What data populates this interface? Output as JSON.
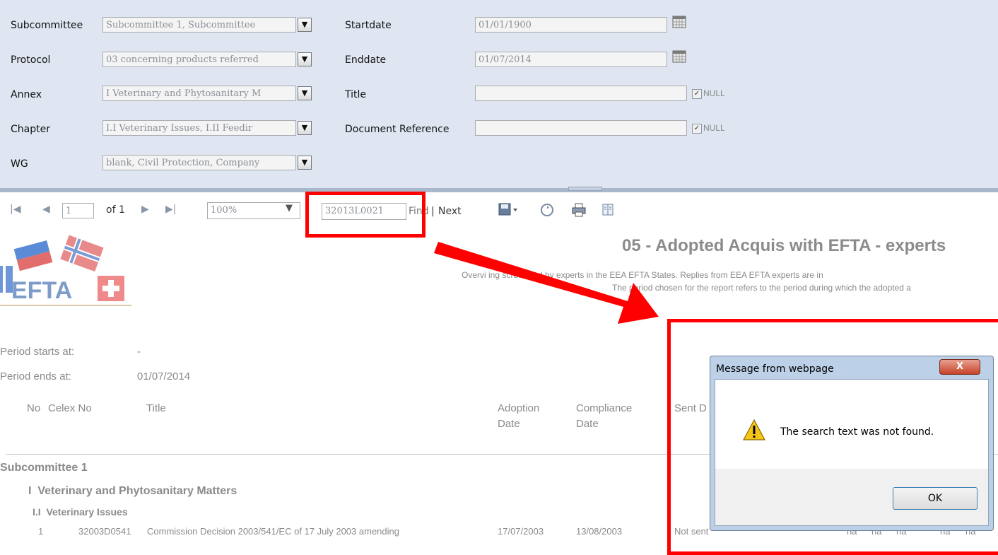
{
  "params": {
    "subcommittee_label": "Subcommittee",
    "subcommittee_value": "Subcommittee 1, Subcommittee",
    "protocol_label": "Protocol",
    "protocol_value": "03 concerning products referred",
    "annex_label": "Annex",
    "annex_value": "I Veterinary and Phytosanitary M",
    "chapter_label": "Chapter",
    "chapter_value": "I.I Veterinary Issues, I.II Feedir",
    "wg_label": "WG",
    "wg_value": "blank, Civil Protection, Company",
    "startdate_label": "Startdate",
    "startdate_value": "01/01/1900",
    "enddate_label": "Enddate",
    "enddate_value": "01/07/2014",
    "title_label": "Title",
    "docref_label": "Document Reference",
    "null_label": "NULL"
  },
  "toolbar": {
    "page_value": "1",
    "page_of": "of 1",
    "zoom_value": "100%",
    "search_value": "32013L0021",
    "find_label": "Find",
    "separator": "|",
    "next_label": "Next"
  },
  "report": {
    "logo_text": "EFTA",
    "title": "05 - Adopted Acquis with EFTA - experts",
    "subtitle_line1": "Overvi                    ing scrutinized by experts in the EEA EFTA States. Replies from EEA EFTA experts are in",
    "subtitle_line2": "The period chosen for the report refers to the period during which the adopted a",
    "period_start_label": "Period starts at:",
    "period_start_value": "-",
    "period_end_label": "Period ends at:",
    "period_end_value": "01/07/2014",
    "columns": {
      "no": "No",
      "celex": "Celex No",
      "title": "Title",
      "adoption_line1": "Adoption",
      "adoption_line2": "Date",
      "compliance_line1": "Compliance",
      "compliance_line2": "Date",
      "sent": "Sent D"
    },
    "group1": "Subcommittee 1",
    "group2": "I  Veterinary and Phytosanitary Matters",
    "group3": "I.I  Veterinary Issues",
    "row": {
      "no": "1",
      "celex": "32003D0541",
      "title": "Commission Decision 2003/541/EC of 17 July 2003 amending",
      "adoption": "17/07/2003",
      "compliance": "13/08/2003",
      "sent": "Not sent"
    },
    "trailing": [
      "na",
      "na",
      "na",
      "na",
      "na"
    ]
  },
  "dialog": {
    "title": "Message from webpage",
    "message": "The search text was not found.",
    "ok_label": "OK",
    "close_label": "X"
  },
  "colors": {
    "annotation": "#ff0000",
    "param_panel": "#dfe6f2"
  }
}
